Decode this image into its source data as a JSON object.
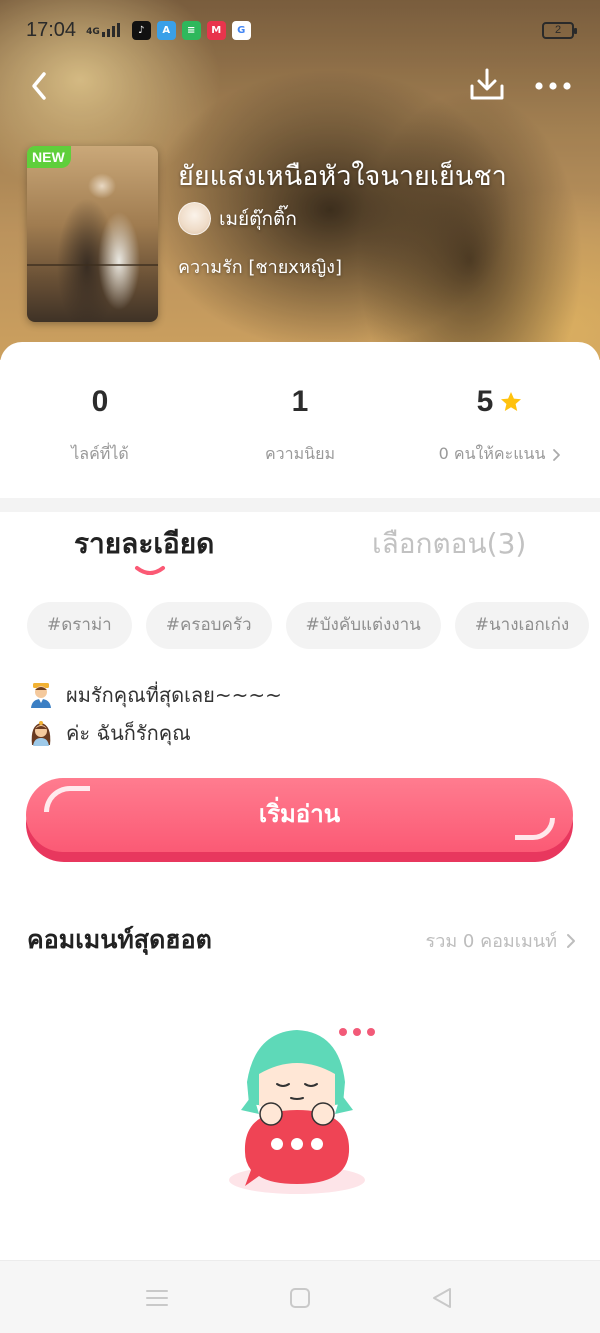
{
  "status_bar": {
    "time": "17:04",
    "network": "4G",
    "battery": "2",
    "apps": [
      {
        "name": "tiktok-icon",
        "glyph": "♪",
        "color": "#111111"
      },
      {
        "name": "translate-app-icon",
        "glyph": "A",
        "color": "#3aa0e8"
      },
      {
        "name": "green-app-icon",
        "glyph": "≡",
        "color": "#2eb85c"
      },
      {
        "name": "mangatoon-icon",
        "glyph": "M",
        "color": "#e8344c"
      },
      {
        "name": "google-icon",
        "glyph": "G",
        "color": "#ffffff"
      }
    ]
  },
  "book": {
    "badge": "NEW",
    "title": "ยัยแสงเหนือหัวใจนายเย็นชา",
    "author": "เมย์ตุ๊กติ๊ก",
    "genre": "ความรัก [ชายxหญิง]"
  },
  "stats": [
    {
      "value": "0",
      "label": "ไลค์ที่ได้"
    },
    {
      "value": "1",
      "label": "ความนิยม"
    },
    {
      "value": "5",
      "label": "0 คนให้คะแนน"
    }
  ],
  "tabs": {
    "details": "รายละเอียด",
    "episodes": "เลือกตอน(3)"
  },
  "tags": [
    "#ดราม่า",
    "#ครอบครัว",
    "#บังคับแต่งงาน",
    "#นางเอกเก่ง"
  ],
  "description": [
    "ผมรักคุณที่สุดเลย~~~~",
    "ค่ะ ฉันก็รักคุณ"
  ],
  "read_button": "เริ่มอ่าน",
  "comments": {
    "title": "คอมเมนท์สุดฮอต",
    "total": "รวม 0 คอมเมนท์"
  },
  "colors": {
    "accent": "#fb5a75",
    "badge": "#5fcf3b",
    "star": "#ffc20e"
  }
}
